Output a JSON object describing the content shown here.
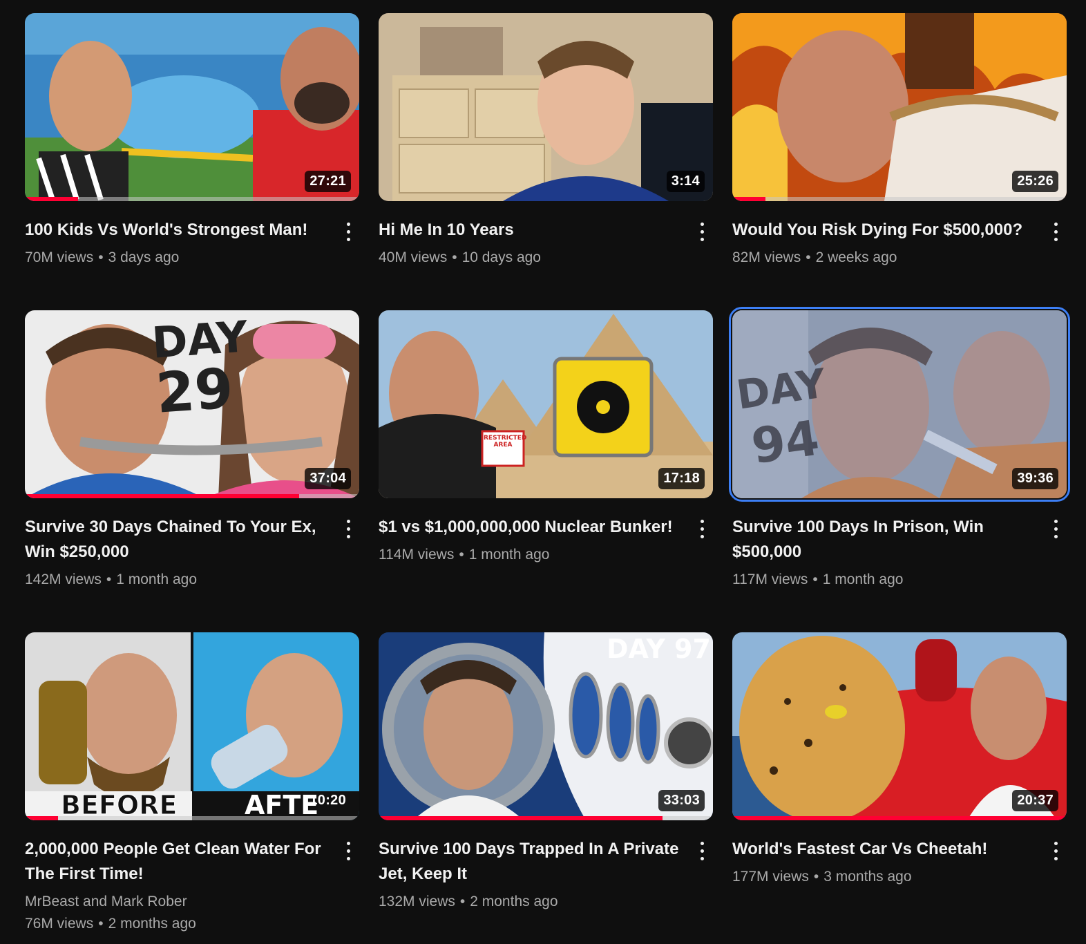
{
  "videos": [
    {
      "title": "100 Kids Vs World's Strongest Man!",
      "views": "70M views",
      "age": "3 days ago",
      "duration": "27:21",
      "watched": 0.16,
      "channel": ""
    },
    {
      "title": "Hi Me In 10 Years",
      "views": "40M views",
      "age": "10 days ago",
      "duration": "3:14",
      "watched": 0,
      "channel": ""
    },
    {
      "title": "Would You Risk Dying For $500,000?",
      "views": "82M views",
      "age": "2 weeks ago",
      "duration": "25:26",
      "watched": 0.1,
      "channel": ""
    },
    {
      "title": "Survive 30 Days Chained To Your Ex, Win $250,000",
      "views": "142M views",
      "age": "1 month ago",
      "duration": "37:04",
      "watched": 0.82,
      "channel": ""
    },
    {
      "title": "$1 vs $1,000,000,000 Nuclear Bunker!",
      "views": "114M views",
      "age": "1 month ago",
      "duration": "17:18",
      "watched": 0,
      "channel": ""
    },
    {
      "title": "Survive 100 Days In Prison, Win $500,000",
      "views": "117M views",
      "age": "1 month ago",
      "duration": "39:36",
      "watched": 0,
      "channel": ""
    },
    {
      "title": "2,000,000 People Get Clean Water For The First Time!",
      "views": "76M views",
      "age": "2 months ago",
      "duration": "10:20",
      "watched": 0.1,
      "channel": "MrBeast and Mark Rober"
    },
    {
      "title": "Survive 100 Days Trapped In A Private Jet, Keep It",
      "views": "132M views",
      "age": "2 months ago",
      "duration": "33:03",
      "watched": 0.85,
      "channel": ""
    },
    {
      "title": "World's Fastest Car Vs Cheetah!",
      "views": "177M views",
      "age": "3 months ago",
      "duration": "20:37",
      "watched": 1.0,
      "channel": ""
    }
  ],
  "thumb_text": {
    "day29_a": "DAY",
    "day29_b": "29",
    "day94_a": "DAY",
    "day94_b": "94",
    "day97": "DAY 97",
    "before": "BEFORE",
    "after": "AFTE",
    "restricted": "RESTRICTED AREA"
  },
  "colors": {
    "accent": "#ff0033",
    "selected": "#3d7ff5",
    "background": "#0f0f0f"
  }
}
